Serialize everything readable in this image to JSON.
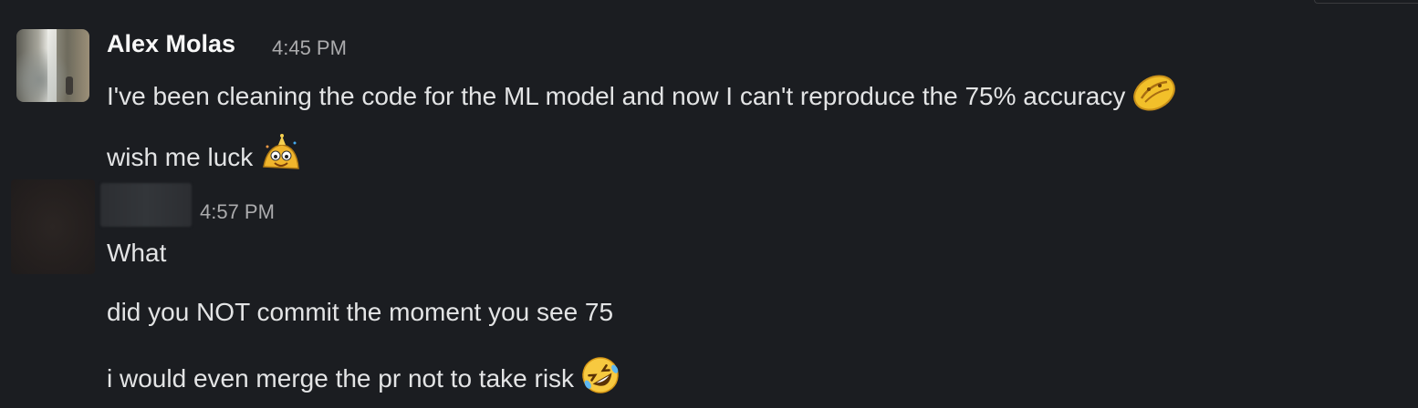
{
  "messages": [
    {
      "author": "Alex Molas",
      "time": "4:45 PM",
      "lines": [
        {
          "text": "I've been cleaning the code for the ML model and now I can't reproduce the 75% accuracy",
          "emoji": "pleading-oval-emoji"
        },
        {
          "text": "wish me luck",
          "emoji": "party-blob-emoji"
        }
      ]
    },
    {
      "author": "",
      "time": "4:57 PM",
      "lines": [
        {
          "text": "What"
        },
        {
          "text": "did you NOT commit the moment you see 75"
        },
        {
          "text": "i would even merge the pr not to take risk",
          "emoji": "rolling-on-floor-laughing-emoji"
        }
      ]
    }
  ]
}
